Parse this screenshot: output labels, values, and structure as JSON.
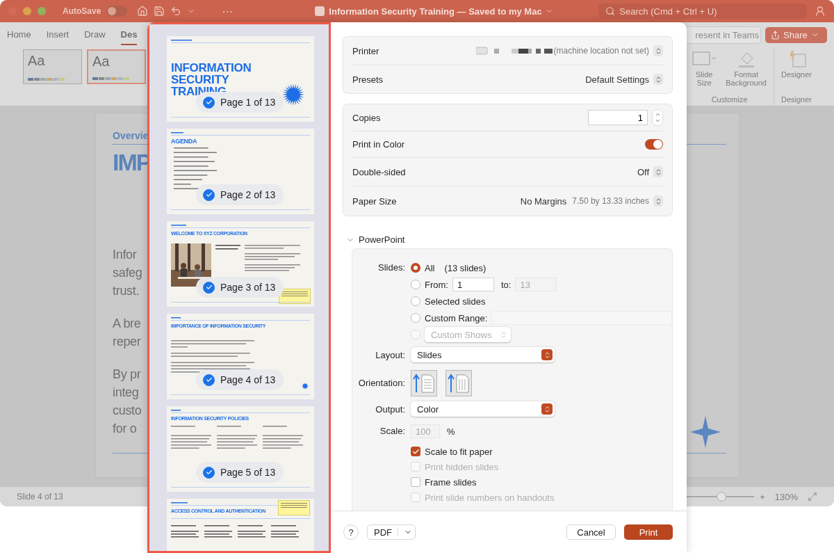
{
  "app": {
    "title_bar": {
      "autosave_label": "AutoSave",
      "autosave_on": false,
      "more": "⋯",
      "document_title": "Information Security Training — Saved to my Mac",
      "search": {
        "placeholder": "Search (Cmd + Ctrl + U)"
      }
    },
    "ribbon_tabs": [
      {
        "label": "Home",
        "selected": false
      },
      {
        "label": "Insert",
        "selected": false
      },
      {
        "label": "Draw",
        "selected": false
      },
      {
        "label": "Des",
        "selected": true
      }
    ],
    "present_button": "resent in Teams",
    "share_button": "Share",
    "themes": [
      {
        "label": "Aa",
        "selected": false
      },
      {
        "label": "Aa",
        "selected": true
      }
    ],
    "ribbon_groups": [
      {
        "label": "Customize",
        "items": [
          {
            "kind": "slide_size",
            "label": "Slide\nSize"
          },
          {
            "kind": "format_background",
            "label": "Format\nBackground"
          }
        ]
      },
      {
        "label": "Designer",
        "items": [
          {
            "kind": "designer",
            "label": "Designer"
          }
        ]
      }
    ],
    "slide": {
      "section": "Overvie",
      "title": "IMP",
      "paragraphs": [
        "Infor\nsafeg\ntrust.",
        "A bre\nreper",
        "By pr\ninteg\ncusto\nfor o"
      ]
    },
    "status_bar": {
      "slide_counter": "Slide 4 of 13",
      "zoom_slider": {
        "level": 0.66
      },
      "plus": "+",
      "zoom": "130%"
    }
  },
  "print_dialog": {
    "previews": [
      {
        "kind": "title",
        "page": "Page 1 of 13",
        "selected": true,
        "title": "INFORMATION SECURITY TRAINING"
      },
      {
        "kind": "agenda",
        "page": "Page 2 of 13",
        "selected": true,
        "title": "AGENDA"
      },
      {
        "kind": "intro",
        "page": "Page 3 of 13",
        "selected": true,
        "title": "WELCOME TO XYZ CORPORATION"
      },
      {
        "kind": "overview",
        "page": "Page 4 of 13",
        "selected": true,
        "title": "IMPORTANCE OF INFORMATION SECURITY"
      },
      {
        "kind": "policies",
        "page": "Page 5 of 13",
        "selected": true,
        "title": "INFORMATION SECURITY POLICIES"
      },
      {
        "kind": "access",
        "title": "ACCESS CONTROL AND AUTHENTICATION"
      }
    ],
    "printer": {
      "label": "Printer",
      "value": "(machine location not set)"
    },
    "presets": {
      "label": "Presets",
      "value": "Default Settings"
    },
    "copies": {
      "label": "Copies",
      "value": "1"
    },
    "print_in_color": {
      "label": "Print in Color",
      "on": true
    },
    "double_sided": {
      "label": "Double-sided",
      "value": "Off"
    },
    "paper_size": {
      "label": "Paper Size",
      "value": "No Margins",
      "detail": "7.50 by 13.33 inches"
    },
    "section": {
      "label": "PowerPoint",
      "expanded": true
    },
    "slides": {
      "label": "Slides:",
      "options": [
        {
          "kind": "all",
          "label": "All",
          "detail": "(13 slides)",
          "selected": true,
          "disabled": false
        },
        {
          "kind": "range",
          "label": "From:",
          "from": "1",
          "to_label": "to:",
          "to": "13",
          "selected": false,
          "disabled": false
        },
        {
          "kind": "plain",
          "label": "Selected slides",
          "selected": false,
          "disabled": false
        },
        {
          "kind": "custom_range",
          "label": "Custom Range:",
          "selected": false,
          "disabled": false
        },
        {
          "kind": "custom_shows",
          "label": "Custom Shows",
          "selected": false,
          "disabled": true
        }
      ]
    },
    "layout": {
      "label": "Layout:",
      "value": "Slides"
    },
    "orientation": {
      "label": "Orientation:",
      "options": [
        {
          "kind": "portrait"
        },
        {
          "kind": "landscape"
        }
      ]
    },
    "output": {
      "label": "Output:",
      "value": "Color"
    },
    "scale": {
      "label": "Scale:",
      "value": "100",
      "unit": "%",
      "disabled": true
    },
    "checkboxes": [
      {
        "label": "Scale to fit paper",
        "checked": true,
        "disabled": false
      },
      {
        "label": "Print hidden slides",
        "checked": false,
        "disabled": true
      },
      {
        "label": "Frame slides",
        "checked": false,
        "disabled": false
      },
      {
        "label": "Print slide numbers on handouts",
        "checked": false,
        "disabled": true
      }
    ],
    "help": "?",
    "pdf": "PDF",
    "cancel": "Cancel",
    "print": "Print"
  }
}
